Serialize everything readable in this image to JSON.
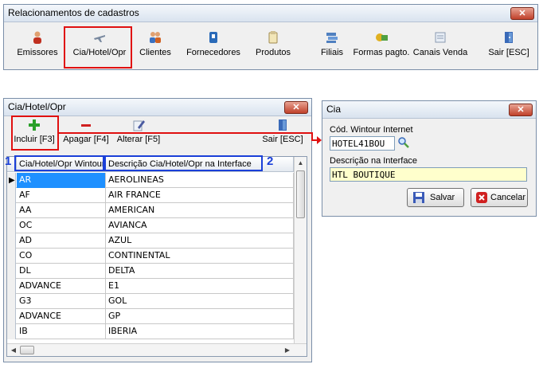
{
  "main_window": {
    "title": "Relacionamentos de cadastros",
    "close": "✕",
    "toolbar": [
      {
        "label": "Emissores",
        "icon": "people-icon"
      },
      {
        "label": "Cia/Hotel/Opr",
        "icon": "airplane-icon"
      },
      {
        "label": "Clientes",
        "icon": "clients-icon"
      },
      {
        "label": "Fornecedores",
        "icon": "supplier-icon"
      },
      {
        "label": "Produtos",
        "icon": "product-icon"
      },
      {
        "label": "Filiais",
        "icon": "branches-icon"
      },
      {
        "label": "Formas pagto.",
        "icon": "payment-icon"
      },
      {
        "label": "Canais Venda",
        "icon": "sales-channel-icon"
      },
      {
        "label": "Sair [ESC]",
        "icon": "exit-door-icon"
      }
    ]
  },
  "list_window": {
    "title": "Cia/Hotel/Opr",
    "close": "✕",
    "toolbar": {
      "include": "Incluir [F3]",
      "delete": "Apagar [F4]",
      "edit": "Alterar [F5]",
      "exit": "Sair [ESC]"
    },
    "columns": [
      "Cia/Hotel/Opr Wintour",
      "Descrição Cia/Hotel/Opr na Interface"
    ],
    "rows": [
      [
        "AR",
        "AEROLINEAS"
      ],
      [
        "AF",
        "AIR FRANCE"
      ],
      [
        "AA",
        "AMERICAN"
      ],
      [
        "OC",
        "AVIANCA"
      ],
      [
        "AD",
        "AZUL"
      ],
      [
        "CO",
        "CONTINENTAL"
      ],
      [
        "DL",
        "DELTA"
      ],
      [
        "ADVANCE",
        "E1"
      ],
      [
        "G3",
        "GOL"
      ],
      [
        "ADVANCE",
        "GP"
      ],
      [
        "IB",
        "IBERIA"
      ]
    ],
    "annotations": [
      "1",
      "2"
    ]
  },
  "dialog": {
    "title": "Cia",
    "close": "✕",
    "code_label": "Cód. Wintour Internet",
    "code_value": "HOTEL41BOU",
    "desc_label": "Descrição na Interface",
    "desc_value": "HTL BOUTIQUE",
    "save": "Salvar",
    "cancel": "Cancelar"
  },
  "colors": {
    "highlight": "#1e90ff",
    "annotation_red": "#e01010",
    "annotation_blue": "#1a3fd8"
  }
}
